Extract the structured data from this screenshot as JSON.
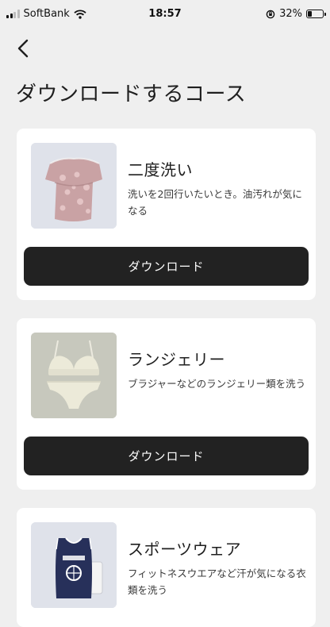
{
  "status_bar": {
    "carrier": "SoftBank",
    "time": "18:57",
    "battery": "32%",
    "battery_level": 0.32
  },
  "header": {
    "back_icon": "chevron-left-icon",
    "title": "ダウンロードするコース"
  },
  "courses": [
    {
      "title": "二度洗い",
      "description": "洗いを2回行いたいとき。油汚れが気になる",
      "button_label": "ダウンロード",
      "thumbnail": "pink-shirt-image"
    },
    {
      "title": "ランジェリー",
      "description": "ブラジャーなどのランジェリー類を洗う",
      "button_label": "ダウンロード",
      "thumbnail": "lingerie-image"
    },
    {
      "title": "スポーツウェア",
      "description": "フィットネスウエアなど汗が気になる衣類を洗う",
      "thumbnail": "sportswear-image"
    }
  ]
}
